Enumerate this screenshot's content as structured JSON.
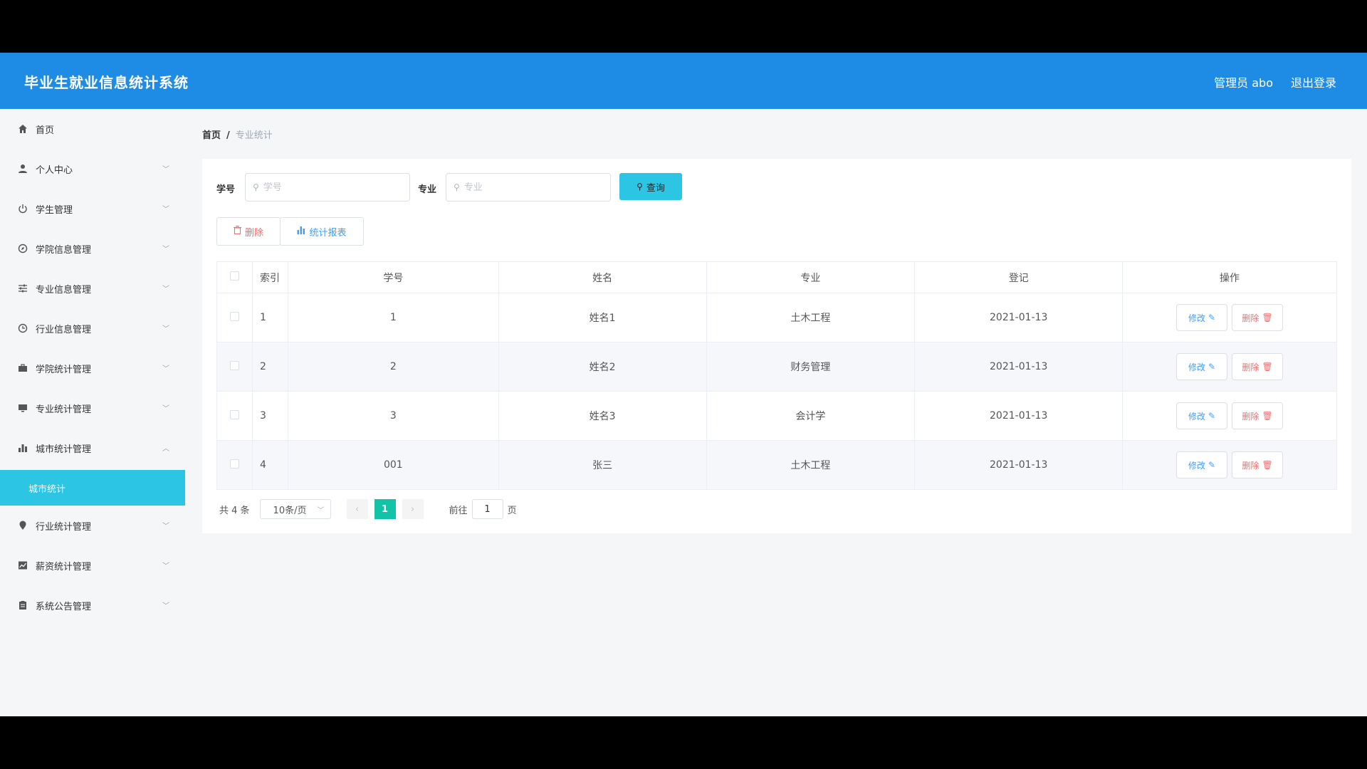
{
  "header": {
    "title": "毕业生就业信息统计系统",
    "user": "管理员 abo",
    "logout": "退出登录"
  },
  "sidebar": {
    "items": [
      {
        "label": "首页",
        "icon": "home-icon",
        "chevron": false
      },
      {
        "label": "个人中心",
        "icon": "user-icon",
        "chevron": true
      },
      {
        "label": "学生管理",
        "icon": "power-icon",
        "chevron": true
      },
      {
        "label": "学院信息管理",
        "icon": "compass-icon",
        "chevron": true
      },
      {
        "label": "专业信息管理",
        "icon": "sliders-icon",
        "chevron": true
      },
      {
        "label": "行业信息管理",
        "icon": "clock-icon",
        "chevron": true
      },
      {
        "label": "学院统计管理",
        "icon": "briefcase-icon",
        "chevron": true
      },
      {
        "label": "专业统计管理",
        "icon": "monitor-icon",
        "chevron": true
      },
      {
        "label": "城市统计管理",
        "icon": "bar-chart-icon",
        "chevron": true,
        "expanded": true
      },
      {
        "label": "行业统计管理",
        "icon": "location-icon",
        "chevron": true
      },
      {
        "label": "薪资统计管理",
        "icon": "line-chart-icon",
        "chevron": true
      },
      {
        "label": "系统公告管理",
        "icon": "clipboard-icon",
        "chevron": true
      }
    ],
    "submenu": {
      "label": "城市统计"
    }
  },
  "breadcrumb": {
    "home": "首页",
    "separator": "/",
    "current": "专业统计"
  },
  "search": {
    "field1_label": "学号",
    "field1_placeholder": "学号",
    "field2_label": "专业",
    "field2_placeholder": "专业",
    "query_label": "查询"
  },
  "actions": {
    "delete_label": "删除",
    "report_label": "统计报表"
  },
  "table": {
    "headers": [
      "索引",
      "学号",
      "姓名",
      "专业",
      "登记",
      "操作"
    ],
    "rows": [
      {
        "index": "1",
        "id": "1",
        "name": "姓名1",
        "major": "土木工程",
        "date": "2021-01-13"
      },
      {
        "index": "2",
        "id": "2",
        "name": "姓名2",
        "major": "财务管理",
        "date": "2021-01-13"
      },
      {
        "index": "3",
        "id": "3",
        "name": "姓名3",
        "major": "会计学",
        "date": "2021-01-13"
      },
      {
        "index": "4",
        "id": "001",
        "name": "张三",
        "major": "土木工程",
        "date": "2021-01-13"
      }
    ],
    "edit_label": "修改",
    "delete_label": "删除"
  },
  "pagination": {
    "total": "共 4 条",
    "page_size": "10条/页",
    "current_page": "1",
    "goto_prefix": "前往",
    "goto_value": "1",
    "goto_suffix": "页"
  },
  "colors": {
    "header": "#1e8ce5",
    "accent": "#2cc5e3",
    "page_active": "#13c3a8"
  }
}
